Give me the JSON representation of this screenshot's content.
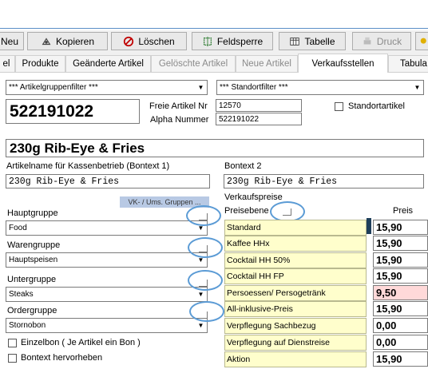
{
  "toolbar": {
    "buttons": [
      {
        "label": "Neu",
        "icon": "new-icon"
      },
      {
        "label": "Kopieren",
        "icon": "copy-icon"
      },
      {
        "label": "Löschen",
        "icon": "delete-icon"
      },
      {
        "label": "Feldsperre",
        "icon": "field-lock-icon"
      },
      {
        "label": "Tabelle",
        "icon": "table-icon"
      },
      {
        "label": "Druck",
        "icon": "print-icon",
        "disabled": true
      }
    ]
  },
  "tabs": [
    {
      "label": "el",
      "active": false
    },
    {
      "label": "Produkte",
      "active": false
    },
    {
      "label": "Geänderte Artikel",
      "active": false
    },
    {
      "label": "Gelöschte Artikel",
      "active": false,
      "dim": true
    },
    {
      "label": "Neue Artikel",
      "active": false,
      "dim": true
    },
    {
      "label": "Verkaufsstellen",
      "active": true
    },
    {
      "label": "Tabula",
      "active": false
    }
  ],
  "filters": {
    "group": "*** Artikelgruppenfilter ***",
    "location": "*** Standortfilter ***"
  },
  "article": {
    "number": "522191022",
    "free_label": "Freie Artikel Nr",
    "free_value": "12570",
    "alpha_label": "Alpha Nummer",
    "alpha_value": "522191022",
    "standort_label": "Standortartikel",
    "name": "230g Rib-Eye & Fries",
    "kasse_label": "Artikelname für Kassenbetrieb (Bontext 1)",
    "kasse_value": "230g Rib-Eye & Fries",
    "bontext2_label": "Bontext 2",
    "bontext2_value": "230g Rib-Eye & Fries"
  },
  "vk_button": "VK- / Ums. Gruppen ...",
  "groups": {
    "haupt_label": "Hauptgruppe",
    "haupt_value": "Food",
    "waren_label": "Warengruppe",
    "waren_value": "Hauptspeisen",
    "unter_label": "Untergruppe",
    "unter_value": "Steaks",
    "order_label": "Ordergruppe",
    "order_value": "Stornobon"
  },
  "checks": {
    "einzelbon": "Einzelbon ( Je Artikel ein Bon )",
    "bontext": "Bontext hervorheben"
  },
  "prices": {
    "header_a": "Verkaufspreise",
    "header_b": "Preisebene",
    "header_price": "Preis",
    "rows": [
      {
        "level": "Standard",
        "price": "15,90"
      },
      {
        "level": "Kaffee HHx",
        "price": "15,90"
      },
      {
        "level": "Cocktail HH 50%",
        "price": "15,90"
      },
      {
        "level": "Cocktail HH FP",
        "price": "15,90"
      },
      {
        "level": "Persoessen/ Persogetränk",
        "price": "9,50",
        "highlight": true
      },
      {
        "level": "All-inklusive-Preis",
        "price": "15,90"
      },
      {
        "level": "Verpflegung Sachbezug",
        "price": "0,00"
      },
      {
        "level": "Verpflegung auf Dienstreise",
        "price": "0,00"
      },
      {
        "level": "Aktion",
        "price": "15,90"
      }
    ]
  },
  "colors": {
    "highlight_ring": "#5b9bd5",
    "price_level_bg": "#fffecc",
    "pink_price_bg": "#ffd9d9"
  }
}
